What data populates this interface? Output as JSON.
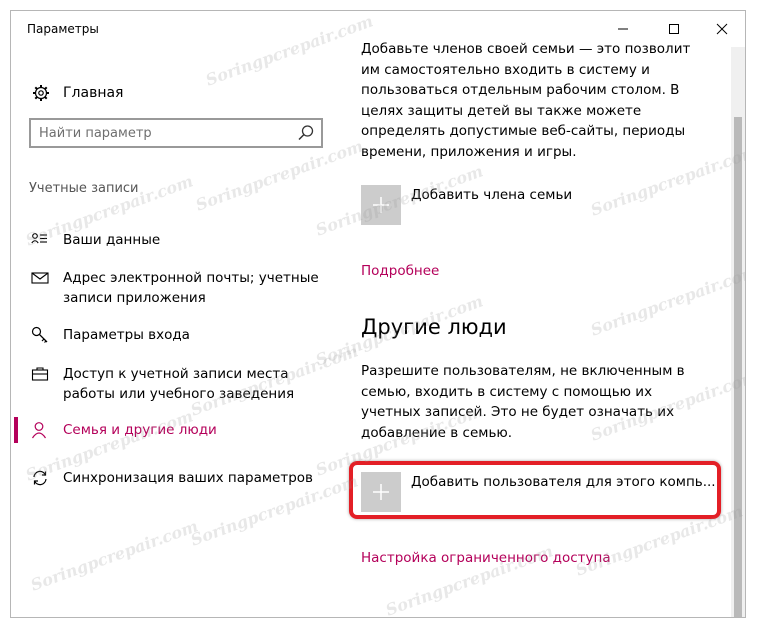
{
  "window": {
    "title": "Параметры"
  },
  "sidebar": {
    "home_label": "Главная",
    "search_placeholder": "Найти параметр",
    "section_label": "Учетные записи",
    "items": [
      {
        "label": "Ваши данные",
        "icon": "person-card-icon"
      },
      {
        "label": "Адрес электронной почты; учетные записи приложения",
        "icon": "mail-icon"
      },
      {
        "label": "Параметры входа",
        "icon": "key-icon"
      },
      {
        "label": "Доступ к учетной записи места работы или учебного заведения",
        "icon": "briefcase-icon"
      },
      {
        "label": "Семья и другие люди",
        "icon": "person-icon",
        "active": true
      },
      {
        "label": "Синхронизация ваших параметров",
        "icon": "sync-icon"
      }
    ]
  },
  "content": {
    "family_text": "Добавьте членов своей семьи — это позволит им самостоятельно входить в систему и пользоваться отдельным рабочим столом. В целях защиты детей вы также можете определять допустимые веб-сайты, периоды времени, приложения и игры.",
    "add_family_label": "Добавить члена семьи",
    "more_link": "Подробнее",
    "other_people_heading": "Другие люди",
    "other_people_text": "Разрешите пользователям, не включенным в семью, входить в систему с помощью их учетных записей. Это не будет означать их добавление в семью.",
    "add_user_label": "Добавить пользователя для этого компь...",
    "assigned_access_link": "Настройка ограниченного доступа"
  },
  "watermark": "Soringpcrepair.com",
  "colors": {
    "accent": "#b4005a",
    "highlight": "#e31f26",
    "plus_tile": "#cccccc"
  }
}
